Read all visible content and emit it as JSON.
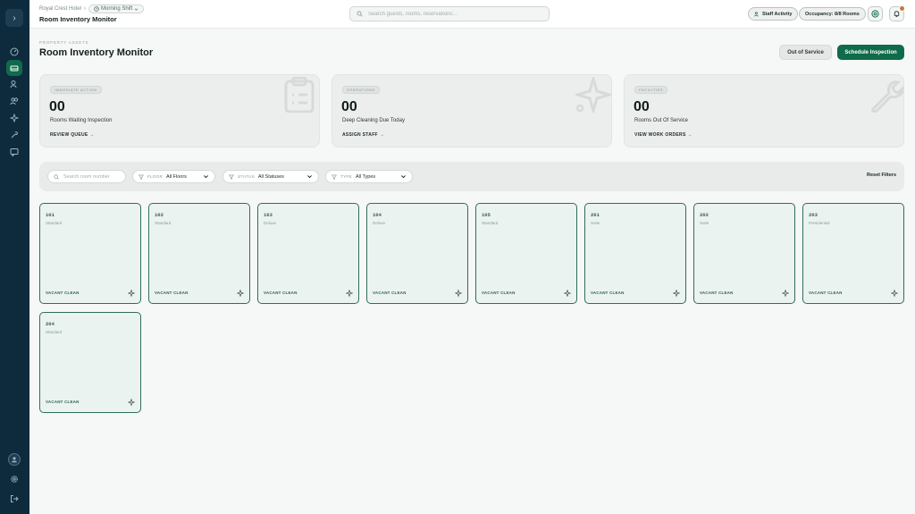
{
  "header": {
    "hotel_name": "Royal Crest Hotel",
    "separator": "›",
    "shift": "Morning Shift",
    "page_heading": "Room Inventory Monitor",
    "search_placeholder": "Search guests, rooms, reservations...",
    "staff_activity": "Staff Activity",
    "occupancy": "Occupancy: 8/8 Rooms"
  },
  "page": {
    "eyebrow": "PROPERTY ASSETS",
    "title": "Room Inventory Monitor",
    "out_of_service_button": "Out of Service",
    "schedule_button": "Schedule Inspection"
  },
  "stats": [
    {
      "tag": "IMMEDIATE ACTION",
      "value": "00",
      "label": "Rooms Waiting Inspection",
      "link": "REVIEW QUEUE →",
      "icon": "clipboard-icon"
    },
    {
      "tag": "OPERATIONS",
      "value": "00",
      "label": "Deep Cleaning Due Today",
      "link": "ASSIGN STAFF →",
      "icon": "sparkle-icon"
    },
    {
      "tag": "FACILITIES",
      "value": "00",
      "label": "Rooms Out Of Service",
      "link": "VIEW WORK ORDERS →",
      "icon": "wrench-icon"
    }
  ],
  "filters": {
    "search_placeholder": "Search room number",
    "floor_label": "FLOOR",
    "floor_value": "All Floors",
    "status_label": "STATUS",
    "status_value": "All Statuses",
    "type_label": "TYPE",
    "type_value": "All Types",
    "reset": "Reset Filters"
  },
  "rooms": [
    {
      "number": "101",
      "type": "Standard",
      "status": "VACANT CLEAN"
    },
    {
      "number": "102",
      "type": "Standard",
      "status": "VACANT CLEAN"
    },
    {
      "number": "103",
      "type": "Deluxe",
      "status": "VACANT CLEAN"
    },
    {
      "number": "104",
      "type": "Deluxe",
      "status": "VACANT CLEAN"
    },
    {
      "number": "105",
      "type": "Standard",
      "status": "VACANT CLEAN"
    },
    {
      "number": "201",
      "type": "Suite",
      "status": "VACANT CLEAN"
    },
    {
      "number": "202",
      "type": "Suite",
      "status": "VACANT CLEAN"
    },
    {
      "number": "203",
      "type": "Presidential",
      "status": "VACANT CLEAN"
    },
    {
      "number": "204",
      "type": "Standard",
      "status": "VACANT CLEAN"
    }
  ],
  "colors": {
    "sidebar": "#0e2b3d",
    "accent": "#0f6b4a",
    "room_border": "#2f6e58",
    "room_bg": "#ebf3f1",
    "notification": "#c9763b"
  },
  "sidebar_icons": [
    "dashboard-icon",
    "rooms-icon",
    "guests-icon",
    "staff-icon",
    "housekeeping-icon",
    "maintenance-icon",
    "messages-icon"
  ]
}
